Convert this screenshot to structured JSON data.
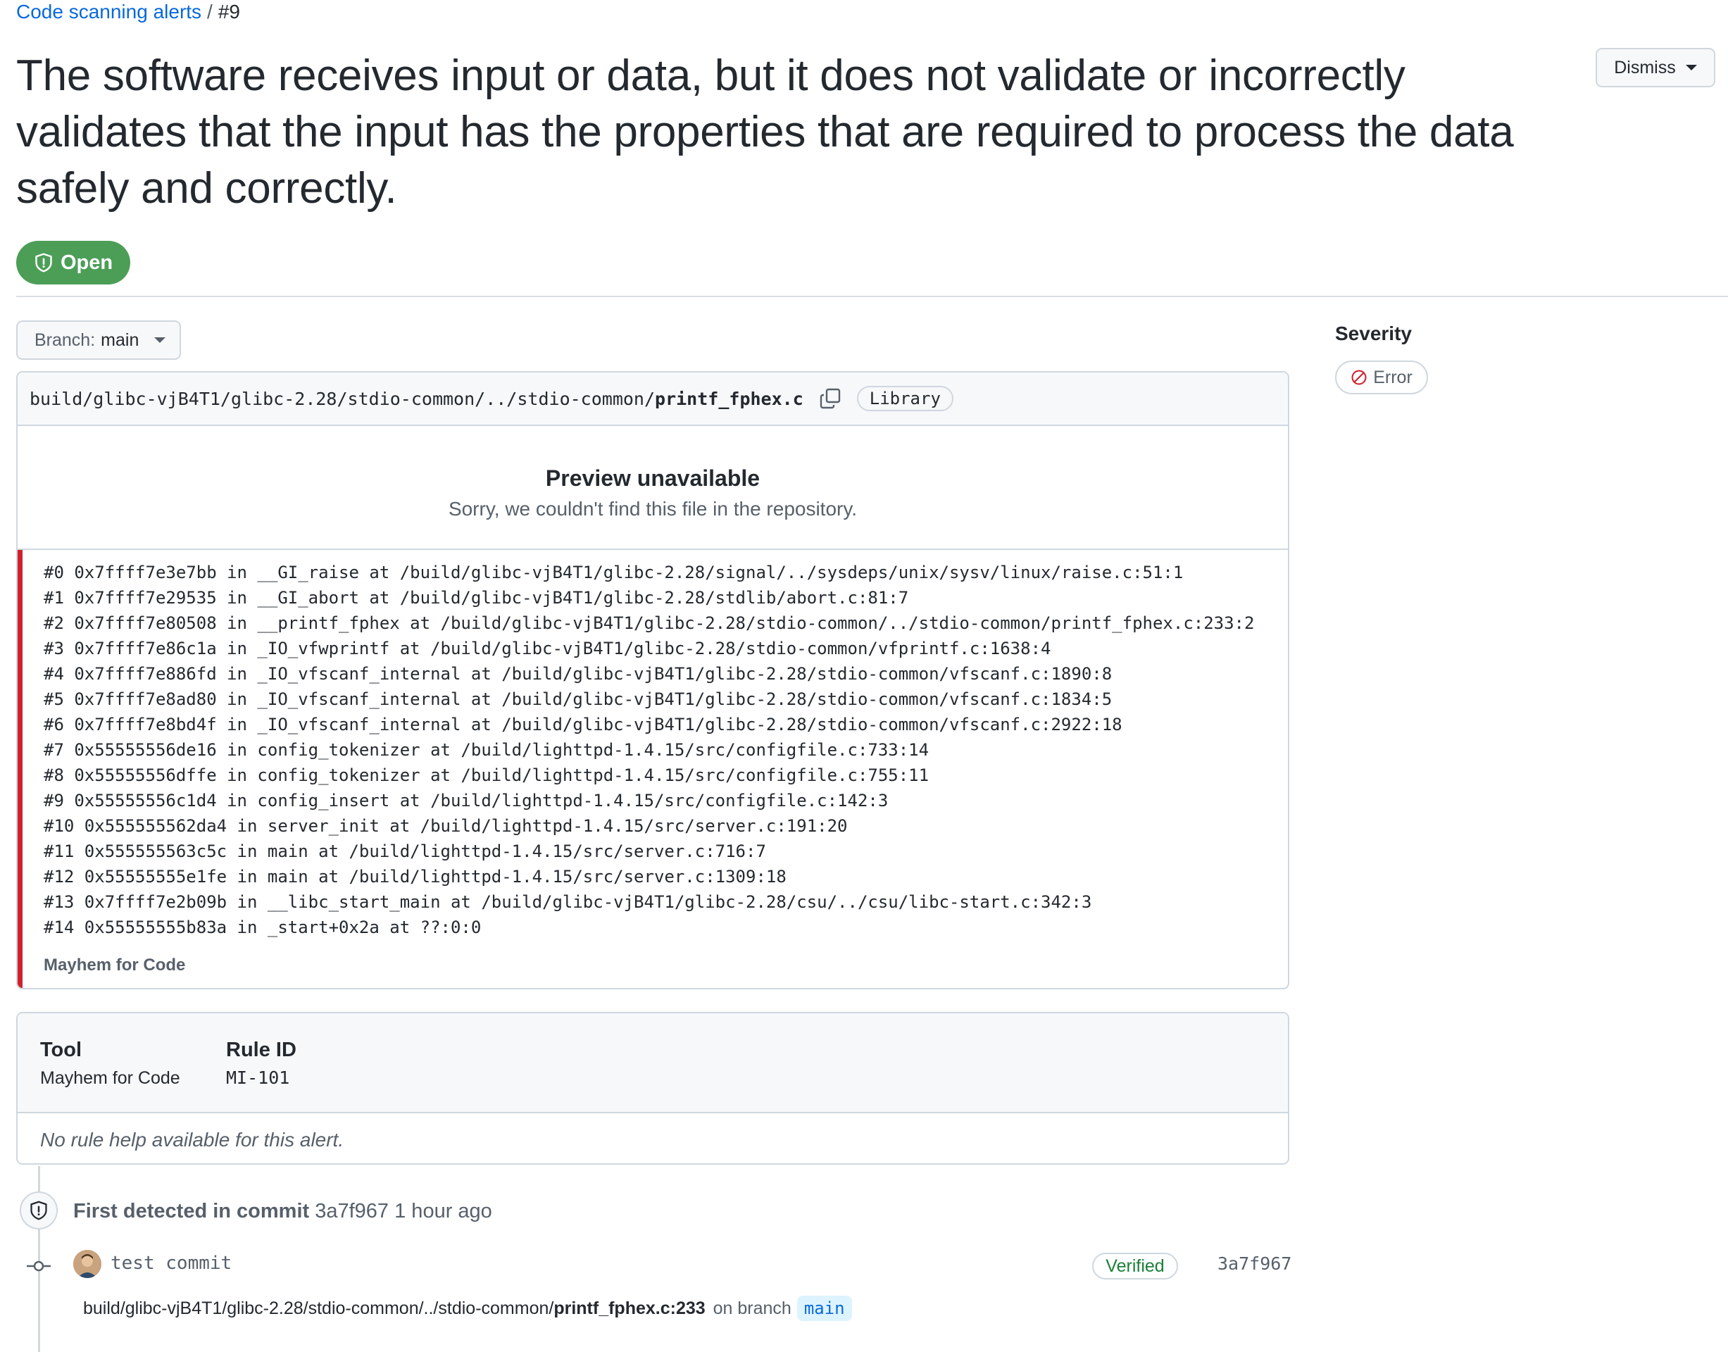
{
  "breadcrumb": {
    "link": "Code scanning alerts",
    "separator": "/",
    "number": "#9"
  },
  "alert": {
    "title": "The software receives input or data, but it does not validate or incorrectly validates that the input has the properties that are required to process the data safely and correctly.",
    "state": "Open",
    "dismiss_label": "Dismiss"
  },
  "branch": {
    "prefix": "Branch:",
    "name": "main"
  },
  "file": {
    "path_base": "build/glibc-vjB4T1/glibc-2.28/stdio-common/../stdio-common/",
    "path_file": "printf_fphex.c",
    "label": "Library",
    "preview_title": "Preview unavailable",
    "preview_subtitle": "Sorry, we couldn't find this file in the repository."
  },
  "trace": {
    "lines": [
      "#0 0x7ffff7e3e7bb in __GI_raise at /build/glibc-vjB4T1/glibc-2.28/signal/../sysdeps/unix/sysv/linux/raise.c:51:1",
      "#1 0x7ffff7e29535 in __GI_abort at /build/glibc-vjB4T1/glibc-2.28/stdlib/abort.c:81:7",
      "#2 0x7ffff7e80508 in __printf_fphex at /build/glibc-vjB4T1/glibc-2.28/stdio-common/../stdio-common/printf_fphex.c:233:2",
      "#3 0x7ffff7e86c1a in _IO_vfwprintf at /build/glibc-vjB4T1/glibc-2.28/stdio-common/vfprintf.c:1638:4",
      "#4 0x7ffff7e886fd in _IO_vfscanf_internal at /build/glibc-vjB4T1/glibc-2.28/stdio-common/vfscanf.c:1890:8",
      "#5 0x7ffff7e8ad80 in _IO_vfscanf_internal at /build/glibc-vjB4T1/glibc-2.28/stdio-common/vfscanf.c:1834:5",
      "#6 0x7ffff7e8bd4f in _IO_vfscanf_internal at /build/glibc-vjB4T1/glibc-2.28/stdio-common/vfscanf.c:2922:18",
      "#7 0x55555556de16 in config_tokenizer at /build/lighttpd-1.4.15/src/configfile.c:733:14",
      "#8 0x55555556dffe in config_tokenizer at /build/lighttpd-1.4.15/src/configfile.c:755:11",
      "#9 0x55555556c1d4 in config_insert at /build/lighttpd-1.4.15/src/configfile.c:142:3",
      "#10 0x555555562da4 in server_init at /build/lighttpd-1.4.15/src/server.c:191:20",
      "#11 0x555555563c5c in main at /build/lighttpd-1.4.15/src/server.c:716:7",
      "#12 0x55555555e1fe in main at /build/lighttpd-1.4.15/src/server.c:1309:18",
      "#13 0x7ffff7e2b09b in __libc_start_main at /build/glibc-vjB4T1/glibc-2.28/csu/../csu/libc-start.c:342:3",
      "#14 0x55555555b83a in _start+0x2a at ??:0:0"
    ],
    "tool": "Mayhem for Code"
  },
  "rule": {
    "tool_label": "Tool",
    "tool_value": "Mayhem for Code",
    "rule_id_label": "Rule ID",
    "rule_id_value": "MI-101",
    "help": "No rule help available for this alert."
  },
  "timeline": {
    "first_detected_prefix": "First detected in commit",
    "first_detected_sha": "3a7f967",
    "first_detected_time": "1 hour ago",
    "commit_message": "test commit",
    "verified_label": "Verified",
    "commit_sha": "3a7f967",
    "location_base": "build/glibc-vjB4T1/glibc-2.28/stdio-common/../stdio-common/",
    "location_file": "printf_fphex.c:233",
    "on_branch_text": "on branch",
    "branch": "main"
  },
  "sidebar": {
    "severity_label": "Severity",
    "severity_value": "Error"
  },
  "colors": {
    "open": "#4c9e57",
    "error_bar": "#cf222e",
    "link": "#0969da",
    "verified": "#1a7f37"
  },
  "icons": {
    "state": "shield-icon",
    "copy": "copy-icon",
    "severity": "stop-icon",
    "commit": "git-commit-icon"
  }
}
